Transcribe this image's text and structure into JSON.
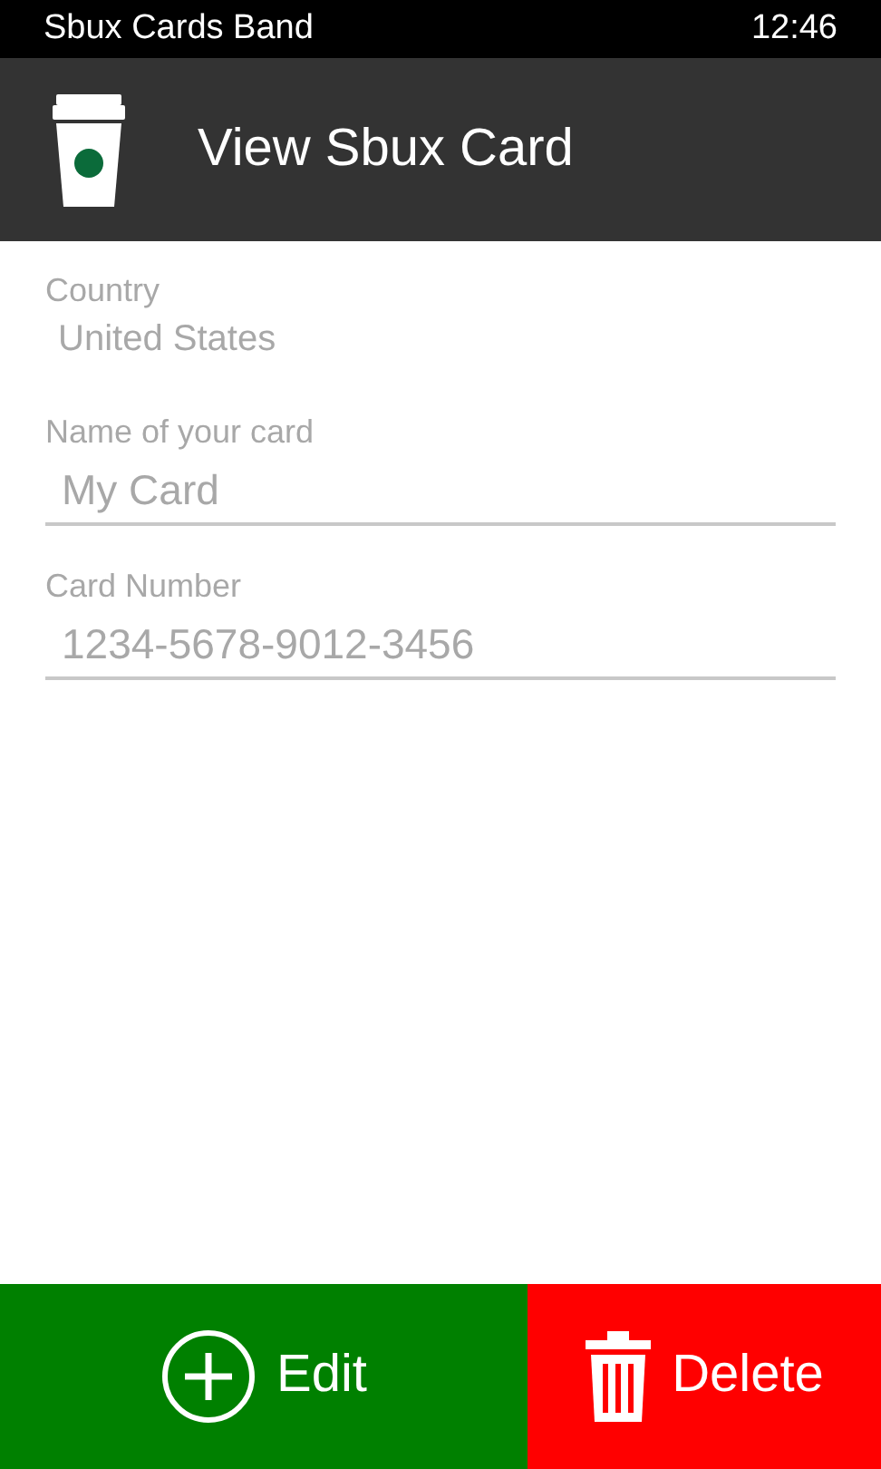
{
  "status_bar": {
    "app_name": "Sbux Cards Band",
    "time": "12:46"
  },
  "header": {
    "title": "View Sbux Card"
  },
  "fields": [
    {
      "kind": "static",
      "label": "Country",
      "value": "United States"
    },
    {
      "kind": "input",
      "label": "Name of your card",
      "value": "My Card"
    },
    {
      "kind": "input",
      "label": "Card Number",
      "value": "1234-5678-9012-3456"
    }
  ],
  "actions": [
    {
      "kind": "edit",
      "label": "Edit"
    },
    {
      "kind": "delete",
      "label": "Delete"
    }
  ]
}
